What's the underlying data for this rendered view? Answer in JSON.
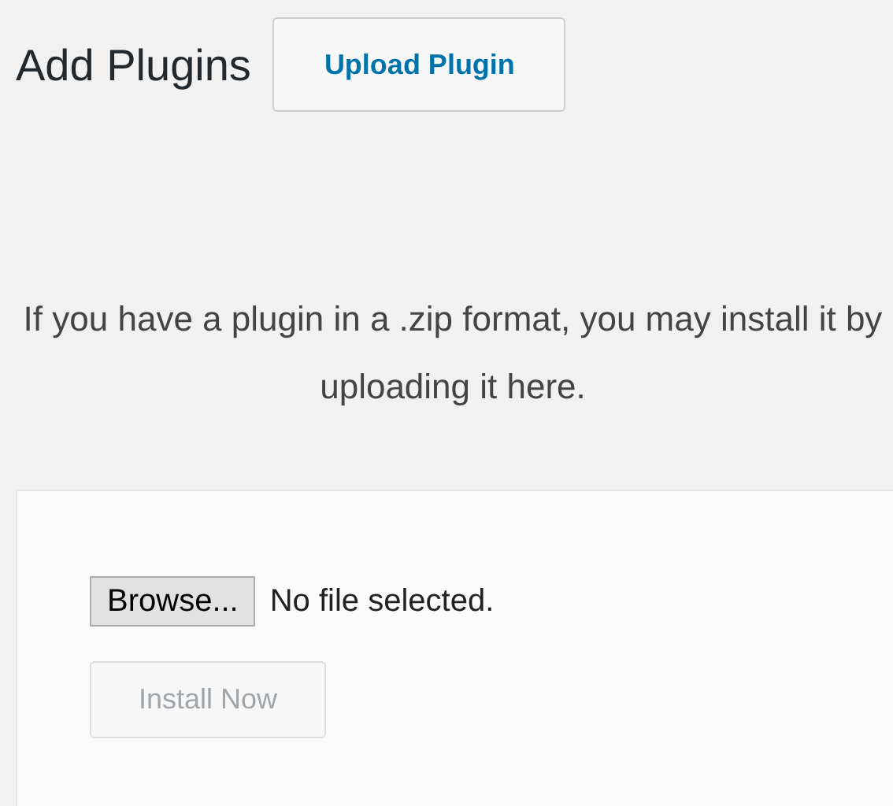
{
  "header": {
    "title": "Add Plugins",
    "upload_button": "Upload Plugin"
  },
  "description": "If you have a plugin in a .zip format, you may install it by uploading it here.",
  "upload_form": {
    "browse_button": "Browse...",
    "file_status": "No file selected.",
    "install_button": {
      "label": "Install Now",
      "disabled": true
    }
  }
}
